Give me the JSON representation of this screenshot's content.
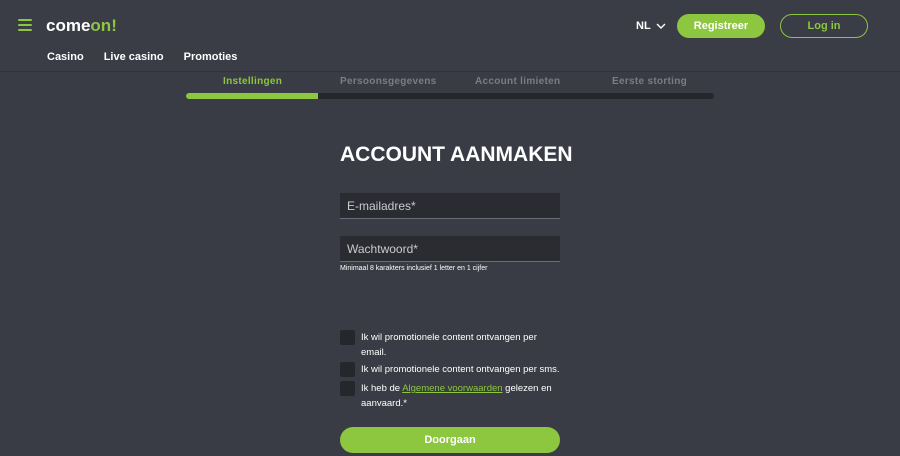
{
  "brand": {
    "logo_main": "come",
    "logo_accent": "on!",
    "accent_color": "#8dc63f"
  },
  "header": {
    "nav": [
      "Casino",
      "Live casino",
      "Promoties"
    ],
    "language": "NL",
    "register_label": "Registreer",
    "login_label": "Log in"
  },
  "steps": {
    "items": [
      "Instellingen",
      "Persoonsgegevens",
      "Account limieten",
      "Eerste storting"
    ],
    "active_index": 0,
    "progress_fraction": 0.25
  },
  "form": {
    "title": "ACCOUNT AANMAKEN",
    "email_placeholder": "E-mailadres*",
    "password_placeholder": "Wachtwoord*",
    "password_hint": "Minimaal 8 karakters inclusief 1 letter en 1 cijfer",
    "checkbox_email": "Ik wil promotionele content ontvangen per email.",
    "checkbox_sms": "Ik wil promotionele content ontvangen per sms.",
    "terms_prefix": "Ik heb de ",
    "terms_link": "Algemene voorwaarden",
    "terms_suffix": " gelezen en aanvaard.*",
    "continue_label": "Doorgaan"
  }
}
